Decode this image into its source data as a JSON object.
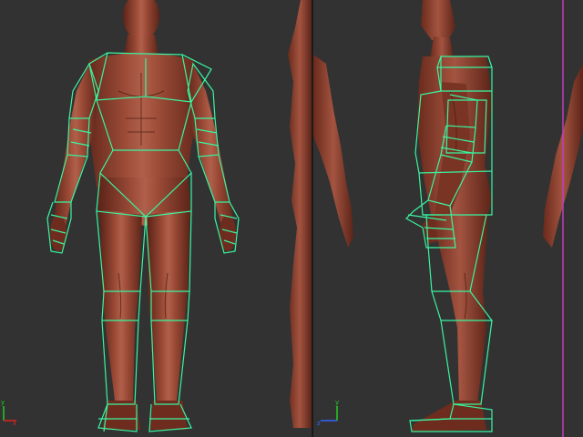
{
  "viewports": [
    {
      "id": "front",
      "label": "front-viewport",
      "axis_gizmo": {
        "up": "y",
        "right": "x"
      }
    },
    {
      "id": "side",
      "label": "side-viewport",
      "axis_gizmo": {
        "up": "y",
        "right": "z"
      }
    }
  ],
  "colors": {
    "background": "#323232",
    "skin": "#8a4030",
    "skin_dark": "#5c2418",
    "skin_light": "#b0604a",
    "cage_wire": "#39f5a0",
    "selection_edge": "#c03cc0",
    "axis_y": "#22cc22",
    "axis_x": "#dd2222",
    "axis_z": "#3366ff"
  }
}
